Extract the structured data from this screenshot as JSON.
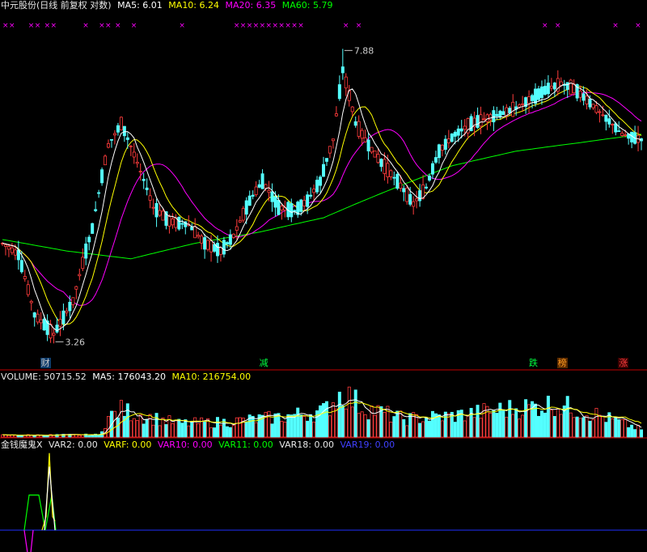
{
  "main_header": {
    "title": "中元股份(日线 前复权 对数)",
    "ma5": "MA5: 6.01",
    "ma10": "MA10: 6.24",
    "ma20": "MA20: 6.35",
    "ma60": "MA60: 5.79"
  },
  "volume_header": {
    "vol": "VOLUME: 50715.52",
    "ma5": "MA5: 176043.20",
    "ma10": "MA10: 216754.00"
  },
  "indicator_header": {
    "name": "金钱魔鬼X",
    "var2": "VAR2: 0.00",
    "varf": "VARF: 0.00",
    "var10": "VAR10: 0.00",
    "var11": "VAR11: 0.00",
    "var18": "VAR18: 0.00",
    "var19": "VAR19: 0.00"
  },
  "markers": [
    {
      "label": "财",
      "color": "#cccccc",
      "bg": "#0a3a6a",
      "index": 13
    },
    {
      "label": "减",
      "color": "#00ff40",
      "bg": "#000000",
      "index": 81
    },
    {
      "label": "跌",
      "color": "#00ff40",
      "bg": "#000000",
      "index": 165
    },
    {
      "label": "榜",
      "color": "#ff9a20",
      "bg": "#5a2a00",
      "index": 174
    },
    {
      "label": "涨",
      "color": "#ff4040",
      "bg": "#3a0000",
      "index": 193
    }
  ],
  "colors": {
    "up": "#ff3c3c",
    "down": "#54ffff",
    "ma5": "#ffffff",
    "ma10": "#ffff00",
    "ma20": "#ff00ff",
    "ma60": "#00ff00",
    "separator": "#c00000",
    "star": "#ff00ff"
  },
  "chart_data": {
    "type": "candlestick",
    "scale": "log",
    "ylim": [
      3.1,
      8.4
    ],
    "high_label": "7.88",
    "low_label": "3.26",
    "high_index": 106,
    "low_index": 16,
    "bars": 200,
    "anchors": [
      [
        0,
        4.4
      ],
      [
        5,
        4.25
      ],
      [
        10,
        3.55
      ],
      [
        16,
        3.35
      ],
      [
        22,
        3.7
      ],
      [
        28,
        4.6
      ],
      [
        33,
        5.9
      ],
      [
        37,
        6.3
      ],
      [
        42,
        5.6
      ],
      [
        47,
        4.9
      ],
      [
        52,
        4.7
      ],
      [
        58,
        4.65
      ],
      [
        63,
        4.4
      ],
      [
        68,
        4.3
      ],
      [
        72,
        4.5
      ],
      [
        77,
        5.0
      ],
      [
        81,
        5.3
      ],
      [
        86,
        4.9
      ],
      [
        91,
        4.85
      ],
      [
        95,
        5.0
      ],
      [
        99,
        5.3
      ],
      [
        103,
        6.0
      ],
      [
        106,
        7.4
      ],
      [
        110,
        6.3
      ],
      [
        114,
        5.9
      ],
      [
        118,
        5.6
      ],
      [
        123,
        5.3
      ],
      [
        128,
        4.95
      ],
      [
        132,
        5.2
      ],
      [
        136,
        5.8
      ],
      [
        141,
        6.1
      ],
      [
        146,
        6.3
      ],
      [
        151,
        6.4
      ],
      [
        156,
        6.5
      ],
      [
        160,
        6.6
      ],
      [
        165,
        6.8
      ],
      [
        170,
        7.0
      ],
      [
        174,
        7.1
      ],
      [
        178,
        7.0
      ],
      [
        183,
        6.7
      ],
      [
        188,
        6.4
      ],
      [
        193,
        6.1
      ],
      [
        199,
        6.0
      ]
    ],
    "ma60_anchors": [
      [
        0,
        4.45
      ],
      [
        20,
        4.3
      ],
      [
        40,
        4.2
      ],
      [
        60,
        4.4
      ],
      [
        80,
        4.55
      ],
      [
        100,
        4.75
      ],
      [
        120,
        5.15
      ],
      [
        140,
        5.55
      ],
      [
        160,
        5.8
      ],
      [
        180,
        5.95
      ],
      [
        199,
        6.1
      ]
    ],
    "volume_anchors": [
      [
        0,
        12000
      ],
      [
        30,
        15000
      ],
      [
        33,
        130000
      ],
      [
        37,
        180000
      ],
      [
        44,
        140000
      ],
      [
        55,
        90000
      ],
      [
        70,
        100000
      ],
      [
        85,
        130000
      ],
      [
        100,
        170000
      ],
      [
        106,
        300000
      ],
      [
        112,
        200000
      ],
      [
        125,
        120000
      ],
      [
        140,
        140000
      ],
      [
        155,
        180000
      ],
      [
        172,
        220000
      ],
      [
        185,
        150000
      ],
      [
        199,
        50000
      ]
    ],
    "indicator_segments": [
      {
        "color": "#ff00ff",
        "points": [
          [
            30,
            0
          ],
          [
            34,
            -1
          ],
          [
            38,
            -1
          ],
          [
            41,
            0
          ]
        ]
      },
      {
        "color": "#00ff00",
        "points": [
          [
            30,
            0
          ],
          [
            36,
            1.55
          ],
          [
            48,
            1.55
          ],
          [
            56,
            0
          ],
          [
            64,
            1.55
          ],
          [
            69,
            0
          ]
        ]
      },
      {
        "color": "#ffff00",
        "points": [
          [
            52,
            0
          ],
          [
            57,
            0.6
          ],
          [
            61,
            3.4
          ],
          [
            65,
            0.6
          ],
          [
            68,
            0.4
          ]
        ]
      },
      {
        "color": "#ffffff",
        "points": [
          [
            55,
            0
          ],
          [
            61,
            2.8
          ],
          [
            68,
            0
          ]
        ]
      }
    ]
  }
}
